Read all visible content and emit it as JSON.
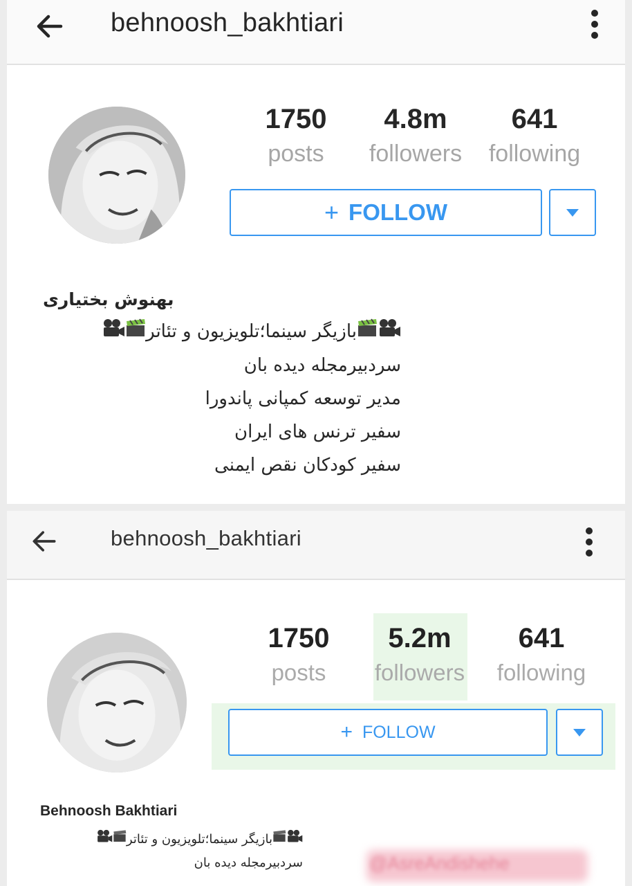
{
  "top": {
    "appbar": {
      "username": "behnoosh_bakhtiari"
    },
    "stats": [
      {
        "value": "1750",
        "label": "posts"
      },
      {
        "value": "4.8m",
        "label": "followers"
      },
      {
        "value": "641",
        "label": "following"
      }
    ],
    "follow_label": "FOLLOW",
    "bio": {
      "name": "بهنوش بختیاری",
      "lines": [
        "بازیگر سینما؛تلویزیون و تئاتر",
        "سردبیرمجله دیده بان",
        "مدیر توسعه کمپانی پاندورا",
        "سفیر ترنس های ایران",
        "سفیر کودکان نقص ایمنی"
      ]
    }
  },
  "bottom": {
    "appbar": {
      "username": "behnoosh_bakhtiari"
    },
    "stats": [
      {
        "value": "1750",
        "label": "posts"
      },
      {
        "value": "5.2m",
        "label": "followers"
      },
      {
        "value": "641",
        "label": "following"
      }
    ],
    "follow_label": "FOLLOW",
    "bio": {
      "name": "Behnoosh Bakhtiari",
      "lines": [
        "بازیگر سینما؛تلویزیون و تئاتر",
        "سردبیرمجله دیده بان"
      ]
    },
    "watermark": "@AsreAndishehe"
  },
  "colors": {
    "accent": "#3897f0",
    "muted": "#a6a6a6",
    "text": "#262626",
    "highlight": "#e9f7e8"
  },
  "icons": [
    "back-arrow-icon",
    "more-vert-icon",
    "dropdown-triangle-icon",
    "movie-camera-icon",
    "clapperboard-icon"
  ]
}
